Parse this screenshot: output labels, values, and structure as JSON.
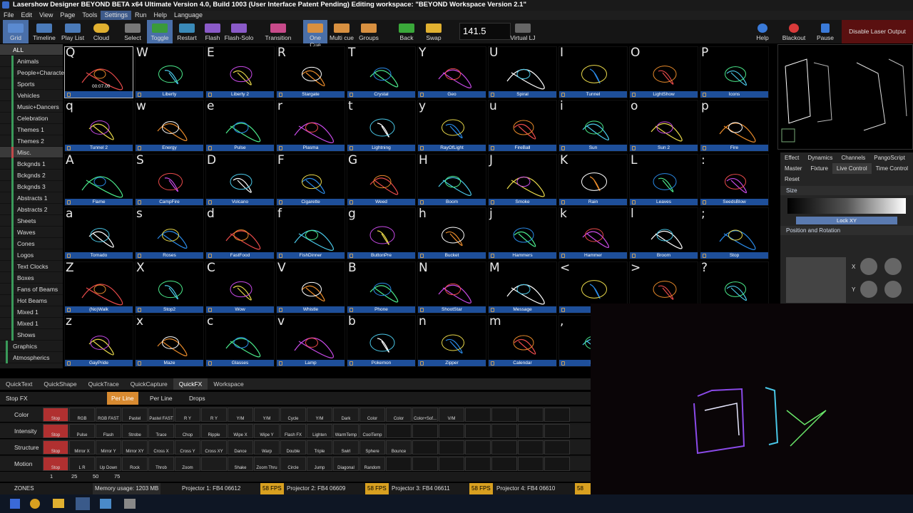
{
  "title": "Lasershow Designer BEYOND BETA x64 Ultimate    Version 4.0, Build 1003  (User Interface Patent Pending)   Editing workspace: \"BEYOND Workspace Version 2.1\"",
  "menu": [
    "File",
    "Edit",
    "View",
    "Page",
    "Tools",
    "Settings",
    "Run",
    "Help",
    "Language"
  ],
  "toolbar": {
    "grid": "Grid",
    "timeline": "Timeline",
    "playlist": "Play List",
    "cloud": "Cloud",
    "select": "Select",
    "toggle": "Toggle",
    "restart": "Restart",
    "flash": "Flash",
    "flashsolo": "Flash-Solo",
    "transition": "Transition",
    "onecue": "One Cue",
    "multicue": "Multi cue",
    "groups": "Groups",
    "back": "Back",
    "swap": "Swap",
    "bpm": "141.5",
    "virtual": "Virtual LJ",
    "help": "Help",
    "blackout": "Blackout",
    "pause": "Pause",
    "disable": "Disable Laser Output"
  },
  "categories": [
    "ALL",
    "Animals",
    "People+Characters",
    "Sports",
    "Vehicles",
    "Music+Dancers",
    "Celebration",
    "Themes 1",
    "Themes 2",
    "Misc.",
    "Bckgnds 1",
    "Bckgnds 2",
    "Bckgnds 3",
    "Abstracts 1",
    "Abstracts 2",
    "Sheets",
    "Waves",
    "Cones",
    "Logos",
    "Text  Clocks",
    "Boxes",
    "Fans of Beams",
    "Hot Beams",
    "Mixed 1",
    "Mixed 1",
    "Shows",
    "Graphics",
    "Atmospherics"
  ],
  "cues": [
    [
      "Q",
      ""
    ],
    [
      "W",
      "Liberty"
    ],
    [
      "E",
      "Liberty 2"
    ],
    [
      "R",
      "Stargate"
    ],
    [
      "T",
      "Crystal"
    ],
    [
      "Y",
      "Geo"
    ],
    [
      "U",
      "Spiral"
    ],
    [
      "I",
      "Tunnel"
    ],
    [
      "O",
      "LightShow"
    ],
    [
      "P",
      "Icons"
    ],
    [
      "q",
      "Tunnel 2"
    ],
    [
      "w",
      "Energy"
    ],
    [
      "e",
      "Pulse"
    ],
    [
      "r",
      "Plasma"
    ],
    [
      "t",
      "Lightning"
    ],
    [
      "y",
      "RayOfLight"
    ],
    [
      "u",
      "FireBall"
    ],
    [
      "i",
      "Sun"
    ],
    [
      "o",
      "Sun 2"
    ],
    [
      "p",
      "Fire"
    ],
    [
      "A",
      "Flame"
    ],
    [
      "S",
      "CampFire"
    ],
    [
      "D",
      "Volcano"
    ],
    [
      "F",
      "Cigarette"
    ],
    [
      "G",
      "Weed"
    ],
    [
      "H",
      "Boom"
    ],
    [
      "J",
      "Smoke"
    ],
    [
      "K",
      "Rain"
    ],
    [
      "L",
      "Leaves"
    ],
    [
      ":",
      "SeedsBlow"
    ],
    [
      "a",
      "Tornado"
    ],
    [
      "s",
      "Roses"
    ],
    [
      "d",
      "FastFood"
    ],
    [
      "f",
      "FishDinner"
    ],
    [
      "g",
      "ButtonPre"
    ],
    [
      "h",
      "Bucket"
    ],
    [
      "j",
      "Hammers"
    ],
    [
      "k",
      "Hammer"
    ],
    [
      "l",
      "Broom"
    ],
    [
      ";",
      "Stop"
    ],
    [
      "Z",
      "(No)Walk"
    ],
    [
      "X",
      "Stop2"
    ],
    [
      "C",
      "Wow"
    ],
    [
      "V",
      "Whistle"
    ],
    [
      "B",
      "Phone"
    ],
    [
      "N",
      "ShootStar"
    ],
    [
      "M",
      "Message"
    ],
    [
      "<",
      "U"
    ],
    [
      ">",
      ""
    ],
    [
      "?",
      ""
    ],
    [
      "z",
      "GayPride"
    ],
    [
      "x",
      "Maze"
    ],
    [
      "c",
      "Glasses"
    ],
    [
      "v",
      "Lamp"
    ],
    [
      "b",
      "Pokemon"
    ],
    [
      "n",
      "Zipper"
    ],
    [
      "m",
      "Calendar"
    ],
    [
      ",",
      "Ho"
    ],
    [
      "",
      ""
    ],
    [
      "",
      ""
    ]
  ],
  "cue_timer": "00:07.00",
  "right_panel": {
    "tabs": [
      "Effect",
      "Dynamics",
      "Channels",
      "PangoScript",
      "Master",
      "Fixture",
      "Live Control",
      "Time Control",
      "Reset"
    ],
    "size": "Size",
    "lock": "Lock XY",
    "posrot": "Position and Rotation",
    "x": "X",
    "y": "Y"
  },
  "bottom_tabs": [
    "QuickText",
    "QuickShape",
    "QuickTrace",
    "QuickCapture",
    "QuickFX",
    "Workspace"
  ],
  "fx": {
    "stop": "Stop FX",
    "perline": "Per Line",
    "perline2": "Per Line",
    "drops": "Drops"
  },
  "fx_rows": [
    {
      "label": "Color",
      "items": [
        "Stop",
        "RGB",
        "RGB FAST",
        "Pastel",
        "Pastel FAST",
        "R Y",
        "R Y",
        "Y/M",
        "Y/M",
        "Cycle",
        "Y/M",
        "Dark",
        "Color",
        "Color",
        "Color+Sof...",
        "V/M"
      ]
    },
    {
      "label": "Intensity",
      "items": [
        "Stop",
        "Pulse",
        "Flash",
        "Strobe",
        "Trace",
        "Chop",
        "Ripple",
        "Wipe X",
        "Wipe Y",
        "Flash FX",
        "Lighten",
        "WarmTemp",
        "CoolTemp"
      ]
    },
    {
      "label": "Structure",
      "items": [
        "Stop",
        "Mirror X",
        "Mirror Y",
        "Mirror XY",
        "Cross X",
        "Cross Y",
        "Cross XY",
        "Dance",
        "Warp",
        "Double",
        "Triple",
        "Swirl",
        "Sphere",
        "Bounce"
      ]
    },
    {
      "label": "Motion",
      "items": [
        "Stop",
        "L R",
        "Up Down",
        "Rock",
        "Throb",
        "Zoom",
        "",
        "Shake",
        "Zoom Thru",
        "Circle",
        "Jump",
        "Diagonal",
        "Random"
      ]
    }
  ],
  "scale": [
    "1",
    "25",
    "50",
    "75"
  ],
  "status": {
    "zones": "ZONES",
    "memory": "Memory usage: 1203 MB",
    "p1": "Projector 1: FB4 06612",
    "p2": "Projector 2: FB4 06609",
    "p3": "Projector 3: FB4 06611",
    "p4": "Projector 4: FB4 06610",
    "fps": "58 FPS"
  }
}
